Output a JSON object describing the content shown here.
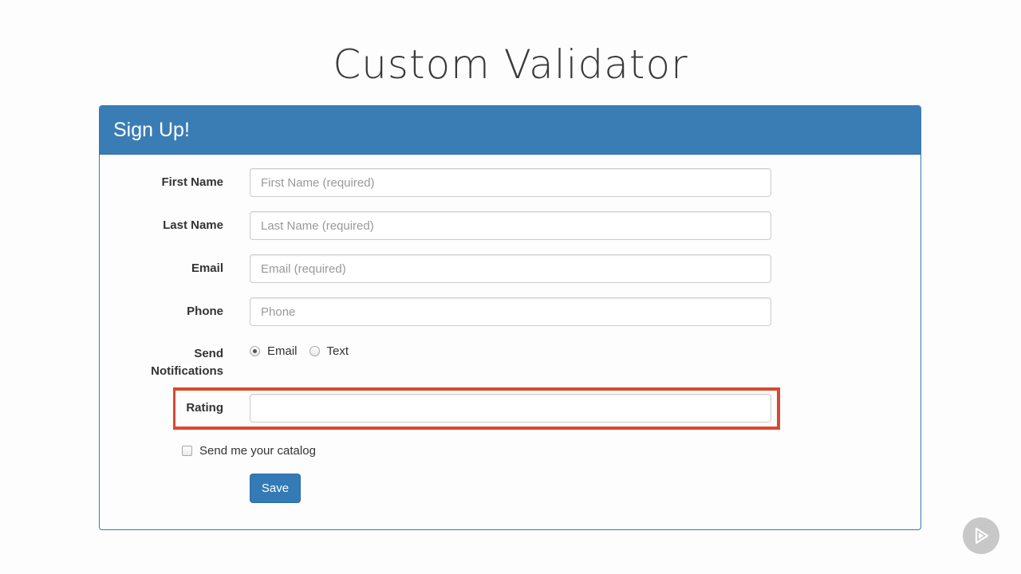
{
  "slide": {
    "title": "Custom Validator"
  },
  "panel": {
    "heading": "Sign Up!"
  },
  "form": {
    "first_name": {
      "label": "First Name",
      "placeholder": "First Name (required)",
      "value": ""
    },
    "last_name": {
      "label": "Last Name",
      "placeholder": "Last Name (required)",
      "value": ""
    },
    "email": {
      "label": "Email",
      "placeholder": "Email (required)",
      "value": ""
    },
    "phone": {
      "label": "Phone",
      "placeholder": "Phone",
      "value": ""
    },
    "notifications": {
      "label_line1": "Send",
      "label_line2": "Notifications",
      "options": [
        {
          "label": "Email",
          "selected": true
        },
        {
          "label": "Text",
          "selected": false
        }
      ]
    },
    "rating": {
      "label": "Rating",
      "value": ""
    },
    "catalog": {
      "label": "Send me your catalog",
      "checked": false
    },
    "save_label": "Save"
  },
  "colors": {
    "panel_header": "#3a7db4",
    "highlight_box": "#d9492f",
    "primary_button": "#337ab7"
  },
  "icons": {
    "badge": "play-logo-icon"
  }
}
